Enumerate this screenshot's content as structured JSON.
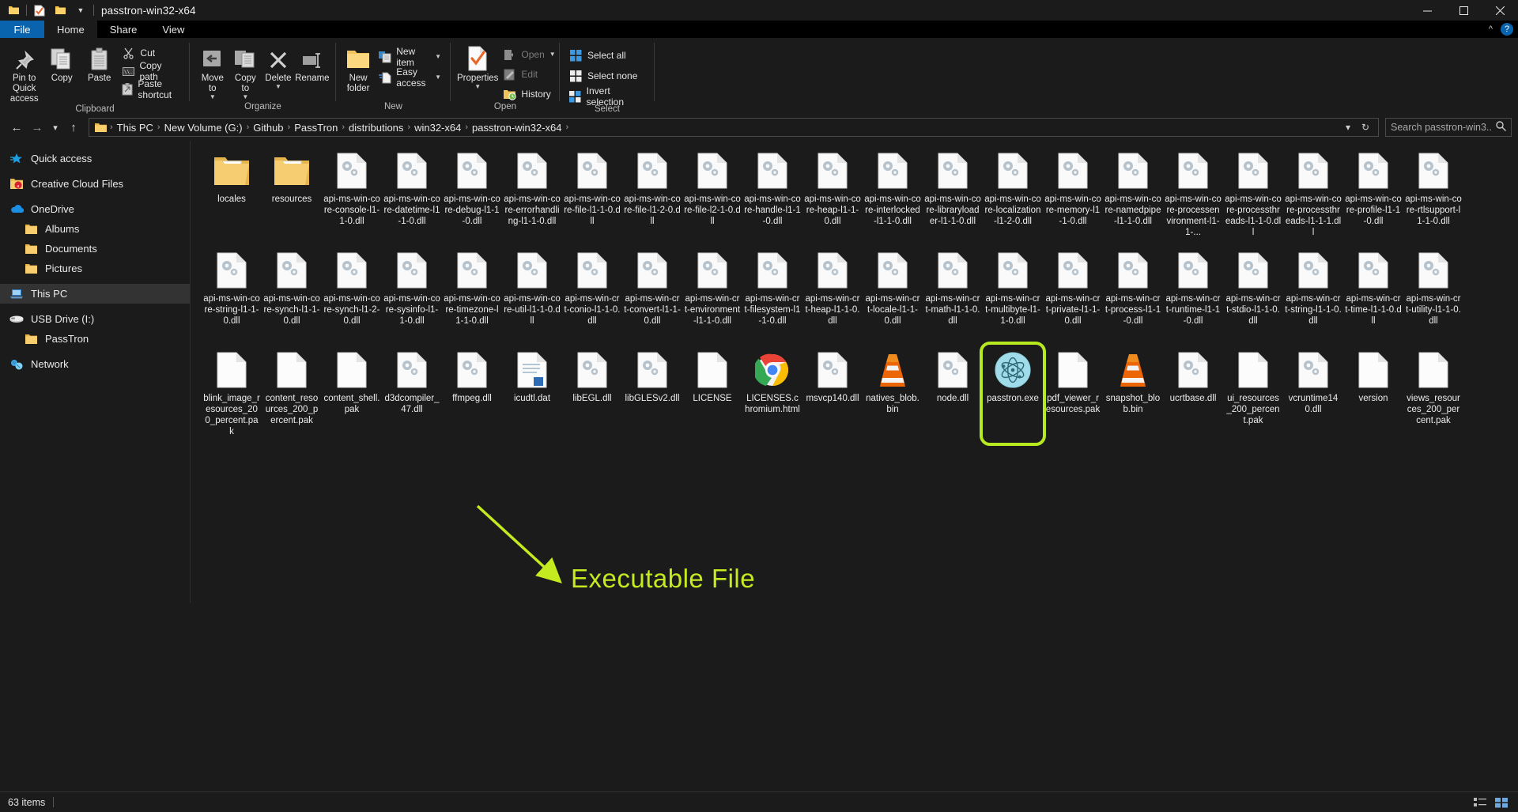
{
  "window": {
    "title": "passtron-win32-x64",
    "quick_access_icons": [
      "folder-icon",
      "properties-check-icon",
      "new-folder-icon",
      "dropdown-caret-icon"
    ],
    "controls": {
      "minimize": "–",
      "maximize": "☐",
      "close": "✕"
    }
  },
  "menu": {
    "tabs": [
      {
        "label": "File",
        "type": "file"
      },
      {
        "label": "Home",
        "type": "active"
      },
      {
        "label": "Share",
        "type": "normal"
      },
      {
        "label": "View",
        "type": "normal"
      }
    ],
    "collapse_caret": "⌃",
    "help_label": "?"
  },
  "ribbon": {
    "groups": [
      {
        "label": "Clipboard",
        "big_buttons": [
          {
            "name": "pin-to-quick-access",
            "label": "Pin to Quick\naccess",
            "icon": "pin-icon"
          },
          {
            "name": "copy",
            "label": "Copy",
            "icon": "copy-icon"
          },
          {
            "name": "paste",
            "label": "Paste",
            "icon": "paste-icon"
          }
        ],
        "small_buttons": [
          {
            "name": "cut",
            "label": "Cut",
            "icon": "scissors-icon"
          },
          {
            "name": "copy-path",
            "label": "Copy path",
            "icon": "copy-path-icon"
          },
          {
            "name": "paste-shortcut",
            "label": "Paste shortcut",
            "icon": "paste-shortcut-icon"
          }
        ]
      },
      {
        "label": "Organize",
        "big_buttons": [
          {
            "name": "move-to",
            "label": "Move\nto",
            "icon": "move-to-icon",
            "caret": true
          },
          {
            "name": "copy-to",
            "label": "Copy\nto",
            "icon": "copy-to-icon",
            "caret": true
          },
          {
            "name": "delete",
            "label": "Delete",
            "icon": "delete-x-icon",
            "caret": true
          },
          {
            "name": "rename",
            "label": "Rename",
            "icon": "rename-icon"
          }
        ],
        "small_buttons": []
      },
      {
        "label": "New",
        "big_buttons": [
          {
            "name": "new-folder",
            "label": "New\nfolder",
            "icon": "new-folder-icon"
          }
        ],
        "small_buttons": [
          {
            "name": "new-item",
            "label": "New item",
            "icon": "new-item-icon",
            "caret": true
          },
          {
            "name": "easy-access",
            "label": "Easy access",
            "icon": "easy-access-icon",
            "caret": true
          }
        ]
      },
      {
        "label": "Open",
        "big_buttons": [
          {
            "name": "properties",
            "label": "Properties",
            "icon": "properties-check-icon",
            "caret": true
          }
        ],
        "small_buttons": [
          {
            "name": "open",
            "label": "Open",
            "icon": "open-icon",
            "caret": true,
            "disabled": true
          },
          {
            "name": "edit",
            "label": "Edit",
            "icon": "edit-pencil-icon",
            "disabled": true
          },
          {
            "name": "history",
            "label": "History",
            "icon": "history-icon"
          }
        ]
      },
      {
        "label": "Select",
        "big_buttons": [],
        "small_buttons": [
          {
            "name": "select-all",
            "label": "Select all",
            "icon": "select-all-icon"
          },
          {
            "name": "select-none",
            "label": "Select none",
            "icon": "select-none-icon"
          },
          {
            "name": "invert-selection",
            "label": "Invert selection",
            "icon": "invert-selection-icon"
          }
        ]
      }
    ]
  },
  "address": {
    "back_icon": "back-arrow-icon",
    "forward_icon": "forward-arrow-icon",
    "recent_icon": "chevron-down-icon",
    "up_icon": "up-arrow-icon",
    "breadcrumbs": [
      "This PC",
      "New Volume (G:)",
      "Github",
      "PassTron",
      "distributions",
      "win32-x64",
      "passtron-win32-x64"
    ],
    "separator": "›",
    "dropdown_icon": "chevron-down-icon",
    "refresh_icon": "refresh-icon"
  },
  "search": {
    "placeholder": "Search passtron-win3...",
    "icon": "search-icon"
  },
  "sidebar": {
    "items": [
      {
        "label": "Quick access",
        "icon": "star-icon",
        "indent": false,
        "selected": false,
        "spacer_before": false
      },
      {
        "label": "Creative Cloud Files",
        "icon": "creative-cloud-icon",
        "indent": false,
        "selected": false,
        "spacer_before": true
      },
      {
        "label": "OneDrive",
        "icon": "onedrive-cloud-icon",
        "indent": false,
        "selected": false,
        "spacer_before": true
      },
      {
        "label": "Albums",
        "icon": "folder-icon",
        "indent": true,
        "selected": false,
        "spacer_before": false
      },
      {
        "label": "Documents",
        "icon": "folder-icon",
        "indent": true,
        "selected": false,
        "spacer_before": false
      },
      {
        "label": "Pictures",
        "icon": "folder-icon",
        "indent": true,
        "selected": false,
        "spacer_before": false
      },
      {
        "label": "This PC",
        "icon": "this-pc-icon",
        "indent": false,
        "selected": true,
        "spacer_before": true
      },
      {
        "label": "USB Drive (I:)",
        "icon": "usb-drive-icon",
        "indent": false,
        "selected": false,
        "spacer_before": true
      },
      {
        "label": "PassTron",
        "icon": "folder-icon",
        "indent": true,
        "selected": false,
        "spacer_before": false
      },
      {
        "label": "Network",
        "icon": "network-icon",
        "indent": false,
        "selected": false,
        "spacer_before": true
      }
    ]
  },
  "files": [
    {
      "name": "locales",
      "type": "folder"
    },
    {
      "name": "resources",
      "type": "folder"
    },
    {
      "name": "api-ms-win-core-console-l1-1-0.dll",
      "type": "dll"
    },
    {
      "name": "api-ms-win-core-datetime-l1-1-0.dll",
      "type": "dll"
    },
    {
      "name": "api-ms-win-core-debug-l1-1-0.dll",
      "type": "dll"
    },
    {
      "name": "api-ms-win-core-errorhandling-l1-1-0.dll",
      "type": "dll"
    },
    {
      "name": "api-ms-win-core-file-l1-1-0.dll",
      "type": "dll"
    },
    {
      "name": "api-ms-win-core-file-l1-2-0.dll",
      "type": "dll"
    },
    {
      "name": "api-ms-win-core-file-l2-1-0.dll",
      "type": "dll"
    },
    {
      "name": "api-ms-win-core-handle-l1-1-0.dll",
      "type": "dll"
    },
    {
      "name": "api-ms-win-core-heap-l1-1-0.dll",
      "type": "dll"
    },
    {
      "name": "api-ms-win-core-interlocked-l1-1-0.dll",
      "type": "dll"
    },
    {
      "name": "api-ms-win-core-libraryloader-l1-1-0.dll",
      "type": "dll"
    },
    {
      "name": "api-ms-win-core-localization-l1-2-0.dll",
      "type": "dll"
    },
    {
      "name": "api-ms-win-core-memory-l1-1-0.dll",
      "type": "dll"
    },
    {
      "name": "api-ms-win-core-namedpipe-l1-1-0.dll",
      "type": "dll"
    },
    {
      "name": "api-ms-win-core-processenvironment-l1-1-...",
      "type": "dll"
    },
    {
      "name": "api-ms-win-core-processthreads-l1-1-0.dll",
      "type": "dll"
    },
    {
      "name": "api-ms-win-core-processthreads-l1-1-1.dll",
      "type": "dll"
    },
    {
      "name": "api-ms-win-core-profile-l1-1-0.dll",
      "type": "dll"
    },
    {
      "name": "api-ms-win-core-rtlsupport-l1-1-0.dll",
      "type": "dll"
    },
    {
      "name": "api-ms-win-core-string-l1-1-0.dll",
      "type": "dll"
    },
    {
      "name": "api-ms-win-core-synch-l1-1-0.dll",
      "type": "dll"
    },
    {
      "name": "api-ms-win-core-synch-l1-2-0.dll",
      "type": "dll"
    },
    {
      "name": "api-ms-win-core-sysinfo-l1-1-0.dll",
      "type": "dll"
    },
    {
      "name": "api-ms-win-core-timezone-l1-1-0.dll",
      "type": "dll"
    },
    {
      "name": "api-ms-win-core-util-l1-1-0.dll",
      "type": "dll"
    },
    {
      "name": "api-ms-win-crt-conio-l1-1-0.dll",
      "type": "dll"
    },
    {
      "name": "api-ms-win-crt-convert-l1-1-0.dll",
      "type": "dll"
    },
    {
      "name": "api-ms-win-crt-environment-l1-1-0.dll",
      "type": "dll"
    },
    {
      "name": "api-ms-win-crt-filesystem-l1-1-0.dll",
      "type": "dll"
    },
    {
      "name": "api-ms-win-crt-heap-l1-1-0.dll",
      "type": "dll"
    },
    {
      "name": "api-ms-win-crt-locale-l1-1-0.dll",
      "type": "dll"
    },
    {
      "name": "api-ms-win-crt-math-l1-1-0.dll",
      "type": "dll"
    },
    {
      "name": "api-ms-win-crt-multibyte-l1-1-0.dll",
      "type": "dll"
    },
    {
      "name": "api-ms-win-crt-private-l1-1-0.dll",
      "type": "dll"
    },
    {
      "name": "api-ms-win-crt-process-l1-1-0.dll",
      "type": "dll"
    },
    {
      "name": "api-ms-win-crt-runtime-l1-1-0.dll",
      "type": "dll"
    },
    {
      "name": "api-ms-win-crt-stdio-l1-1-0.dll",
      "type": "dll"
    },
    {
      "name": "api-ms-win-crt-string-l1-1-0.dll",
      "type": "dll"
    },
    {
      "name": "api-ms-win-crt-time-l1-1-0.dll",
      "type": "dll"
    },
    {
      "name": "api-ms-win-crt-utility-l1-1-0.dll",
      "type": "dll"
    },
    {
      "name": "blink_image_resources_200_percent.pak",
      "type": "blank"
    },
    {
      "name": "content_resources_200_percent.pak",
      "type": "blank"
    },
    {
      "name": "content_shell.pak",
      "type": "blank"
    },
    {
      "name": "d3dcompiler_47.dll",
      "type": "dll"
    },
    {
      "name": "ffmpeg.dll",
      "type": "dll"
    },
    {
      "name": "icudtl.dat",
      "type": "dat"
    },
    {
      "name": "libEGL.dll",
      "type": "dll"
    },
    {
      "name": "libGLESv2.dll",
      "type": "dll"
    },
    {
      "name": "LICENSE",
      "type": "blank"
    },
    {
      "name": "LICENSES.chromium.html",
      "type": "chrome"
    },
    {
      "name": "msvcp140.dll",
      "type": "dll"
    },
    {
      "name": "natives_blob.bin",
      "type": "vlc"
    },
    {
      "name": "node.dll",
      "type": "dll"
    },
    {
      "name": "passtron.exe",
      "type": "electron",
      "highlighted": true
    },
    {
      "name": "pdf_viewer_resources.pak",
      "type": "blank"
    },
    {
      "name": "snapshot_blob.bin",
      "type": "vlc"
    },
    {
      "name": "ucrtbase.dll",
      "type": "dll"
    },
    {
      "name": "ui_resources_200_percent.pak",
      "type": "blank"
    },
    {
      "name": "vcruntime140.dll",
      "type": "dll"
    },
    {
      "name": "version",
      "type": "blank"
    },
    {
      "name": "views_resources_200_percent.pak",
      "type": "blank"
    }
  ],
  "annotation": {
    "text": "Executable File",
    "color": "#c4ea20"
  },
  "statusbar": {
    "item_count": "63 items",
    "view_icons": [
      "details-view-icon",
      "large-icons-view-icon"
    ]
  }
}
